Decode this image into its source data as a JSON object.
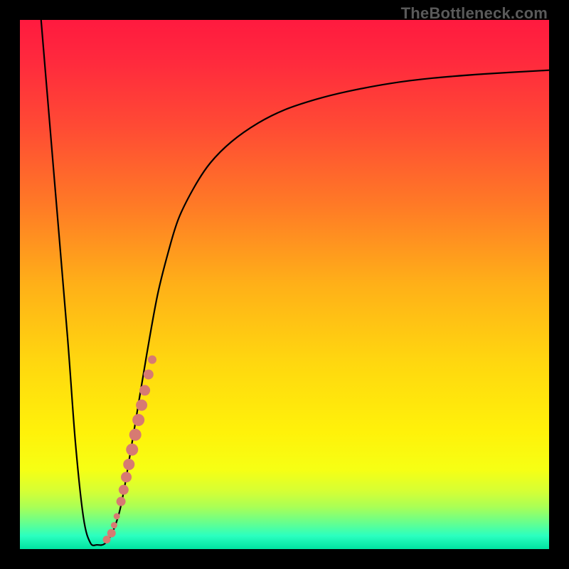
{
  "watermark": "TheBottleneck.com",
  "chart_data": {
    "type": "line",
    "title": "",
    "xlabel": "",
    "ylabel": "",
    "xlim": [
      0,
      100
    ],
    "ylim": [
      0,
      100
    ],
    "grid": false,
    "legend": false,
    "background_gradient": {
      "stops": [
        {
          "offset": 0.0,
          "color": "#ff1a3f"
        },
        {
          "offset": 0.08,
          "color": "#ff2a3d"
        },
        {
          "offset": 0.2,
          "color": "#ff4a34"
        },
        {
          "offset": 0.35,
          "color": "#ff7a26"
        },
        {
          "offset": 0.5,
          "color": "#ffb018"
        },
        {
          "offset": 0.65,
          "color": "#ffd80f"
        },
        {
          "offset": 0.78,
          "color": "#fff20a"
        },
        {
          "offset": 0.85,
          "color": "#f6ff14"
        },
        {
          "offset": 0.89,
          "color": "#d6ff34"
        },
        {
          "offset": 0.92,
          "color": "#aaff55"
        },
        {
          "offset": 0.95,
          "color": "#66ff8e"
        },
        {
          "offset": 0.975,
          "color": "#2affc0"
        },
        {
          "offset": 1.0,
          "color": "#00e3a0"
        }
      ]
    },
    "series": [
      {
        "name": "bottleneck-curve",
        "x": [
          4.0,
          6.5,
          9.0,
          10.5,
          12.0,
          13.3,
          14.6,
          16.0,
          17.4,
          18.8,
          20.0,
          22.0,
          24.0,
          26.0,
          28.0,
          30.0,
          33.0,
          36.0,
          40.0,
          45.0,
          50.0,
          56.0,
          62.0,
          70.0,
          78.0,
          88.0,
          100.0
        ],
        "y": [
          100.0,
          70.0,
          40.0,
          20.0,
          6.0,
          1.2,
          0.8,
          1.0,
          3.0,
          7.0,
          13.0,
          25.0,
          37.0,
          48.0,
          56.0,
          62.5,
          68.5,
          73.0,
          77.0,
          80.5,
          83.0,
          85.0,
          86.5,
          88.0,
          89.0,
          89.8,
          90.5
        ]
      }
    ],
    "markers": {
      "name": "highlighted-dots",
      "color": "#d77a72",
      "points": [
        {
          "x": 16.4,
          "y": 1.8,
          "r": 5.5
        },
        {
          "x": 17.3,
          "y": 3.0,
          "r": 6.0
        },
        {
          "x": 17.8,
          "y": 4.5,
          "r": 4.5
        },
        {
          "x": 18.3,
          "y": 6.2,
          "r": 4.5
        },
        {
          "x": 19.1,
          "y": 9.0,
          "r": 6.5
        },
        {
          "x": 19.6,
          "y": 11.2,
          "r": 7.0
        },
        {
          "x": 20.1,
          "y": 13.6,
          "r": 7.5
        },
        {
          "x": 20.6,
          "y": 16.0,
          "r": 8.0
        },
        {
          "x": 21.2,
          "y": 18.8,
          "r": 8.5
        },
        {
          "x": 21.8,
          "y": 21.6,
          "r": 8.5
        },
        {
          "x": 22.4,
          "y": 24.4,
          "r": 8.5
        },
        {
          "x": 23.0,
          "y": 27.2,
          "r": 8.0
        },
        {
          "x": 23.6,
          "y": 30.0,
          "r": 7.5
        },
        {
          "x": 24.3,
          "y": 33.0,
          "r": 7.0
        },
        {
          "x": 25.0,
          "y": 35.8,
          "r": 6.0
        }
      ]
    }
  }
}
